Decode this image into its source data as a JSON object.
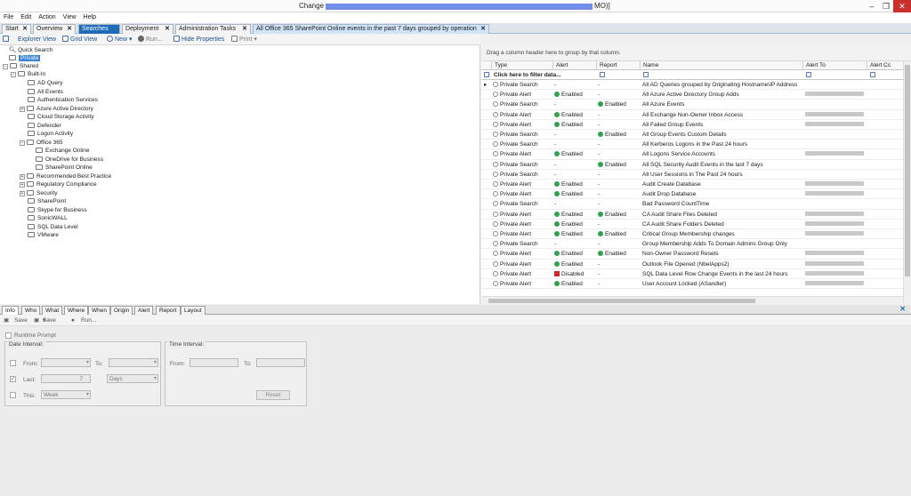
{
  "window": {
    "title_prefix": "Change",
    "title_suffix": "MO)]"
  },
  "menu": [
    "File",
    "Edit",
    "Action",
    "View",
    "Help"
  ],
  "tabs": [
    {
      "label": "Start"
    },
    {
      "label": "Overview"
    },
    {
      "label": "Searches"
    },
    {
      "label": "Deployment"
    },
    {
      "label": "Administration Tasks"
    },
    {
      "label": "All Office 365 SharePoint Online events in the past 7 days grouped by operation"
    }
  ],
  "toolbar": {
    "explorer_view": "Explorer View",
    "grid_view": "Grid View",
    "new": "New",
    "run": "Run...",
    "hide_properties": "Hide Properties",
    "print": "Print"
  },
  "tree": {
    "quick_search": "Quick Search",
    "private": "Private",
    "shared": "Shared",
    "built_in": "Built-In",
    "items": [
      "AD Query",
      "All Events",
      "Authentication Services",
      "Azure Active Directory",
      "Cloud Storage Activity",
      "Defender",
      "Logon Activity",
      "Office 365"
    ],
    "office_children": [
      "Exchange Online",
      "OneDrive for Business",
      "SharePoint Online"
    ],
    "items2": [
      "Recommended Best Practice",
      "Regulatory Compliance",
      "Security",
      "SharePoint",
      "Skype for Business",
      "SonicWALL",
      "SQL Data Level",
      "VMware"
    ]
  },
  "grid": {
    "group_hint": "Drag a column header here to group by that column.",
    "columns": {
      "type": "Type",
      "alert": "Alert",
      "report": "Report",
      "name": "Name",
      "alert_to": "Alert To",
      "alert_cc": "Alert Cc"
    },
    "filter_text": "Click here to filter data...",
    "rows": [
      {
        "type": "Private Search",
        "alert": "-",
        "report": "-",
        "name": "All AD Queries grouped by Originating Hostname\\IP Address"
      },
      {
        "type": "Private Alert",
        "alert": "Enabled",
        "report": "-",
        "name": "All Azure Active Directory Group Adds"
      },
      {
        "type": "Private Search",
        "alert": "-",
        "report": "Enabled",
        "name": "All Azure Events"
      },
      {
        "type": "Private Alert",
        "alert": "Enabled",
        "report": "-",
        "name": "All Exchange Non-Owner Inbox Access"
      },
      {
        "type": "Private Alert",
        "alert": "Enabled",
        "report": "-",
        "name": "All Failed Group Events"
      },
      {
        "type": "Private Search",
        "alert": "-",
        "report": "Enabled",
        "name": "All Group Events Custom Details"
      },
      {
        "type": "Private Search",
        "alert": "-",
        "report": "-",
        "name": "All Kerberos Logons in the Past 24 hours"
      },
      {
        "type": "Private Alert",
        "alert": "Enabled",
        "report": "-",
        "name": "All Logons Service Accounts"
      },
      {
        "type": "Private Search",
        "alert": "-",
        "report": "Enabled",
        "name": "All SQL Security Audit Events in the last 7 days"
      },
      {
        "type": "Private Search",
        "alert": "-",
        "report": "-",
        "name": "All User Sessions in The Past 24 hours"
      },
      {
        "type": "Private Alert",
        "alert": "Enabled",
        "report": "-",
        "name": "Audit Create Database"
      },
      {
        "type": "Private Alert",
        "alert": "Enabled",
        "report": "-",
        "name": "Audit Drop Database"
      },
      {
        "type": "Private Search",
        "alert": "-",
        "report": "-",
        "name": "Bad Password CountTime"
      },
      {
        "type": "Private Alert",
        "alert": "Enabled",
        "report": "Enabled",
        "name": "CA Audit Share Files Deleted"
      },
      {
        "type": "Private Alert",
        "alert": "Enabled",
        "report": "-",
        "name": "CA Audit Share Folders Deleted"
      },
      {
        "type": "Private Alert",
        "alert": "Enabled",
        "report": "Enabled",
        "name": "Critical Group Membership changes"
      },
      {
        "type": "Private Search",
        "alert": "-",
        "report": "-",
        "name": "Group Membership Adds To Domain Admins Group Only"
      },
      {
        "type": "Private Alert",
        "alert": "Enabled",
        "report": "Enabled",
        "name": "Non-Owner Password Resets"
      },
      {
        "type": "Private Alert",
        "alert": "Enabled",
        "report": "-",
        "name": "Outlook File Opened (NbelApps2)"
      },
      {
        "type": "Private Alert",
        "alert": "Disabled",
        "report": "-",
        "name": "SQL Data Level Row Change Events in the last 24 hours"
      },
      {
        "type": "Private Alert",
        "alert": "Enabled",
        "report": "-",
        "name": "User Account Locked (ASandler)"
      }
    ]
  },
  "bottom_tabs": [
    "Info",
    "Who",
    "What",
    "Where",
    "When",
    "Origin",
    "Alert",
    "Report",
    "Layout"
  ],
  "bottom_toolbar": {
    "save": "Save",
    "save_as": "Save As",
    "run": "Run..."
  },
  "runtime": {
    "runtime_prompt": "Runtime Prompt",
    "date_interval": "Date Interval:",
    "time_interval": "Time Interval:",
    "from": "From:",
    "to": "To:",
    "last": "Last:",
    "last_value": "7",
    "last_unit": "Days",
    "this": "This:",
    "this_value": "Week",
    "reset": "Reset"
  },
  "colors": {
    "accent": "#1e6bb8",
    "enabled": "#2ea44a",
    "disabled": "#d3271f"
  }
}
